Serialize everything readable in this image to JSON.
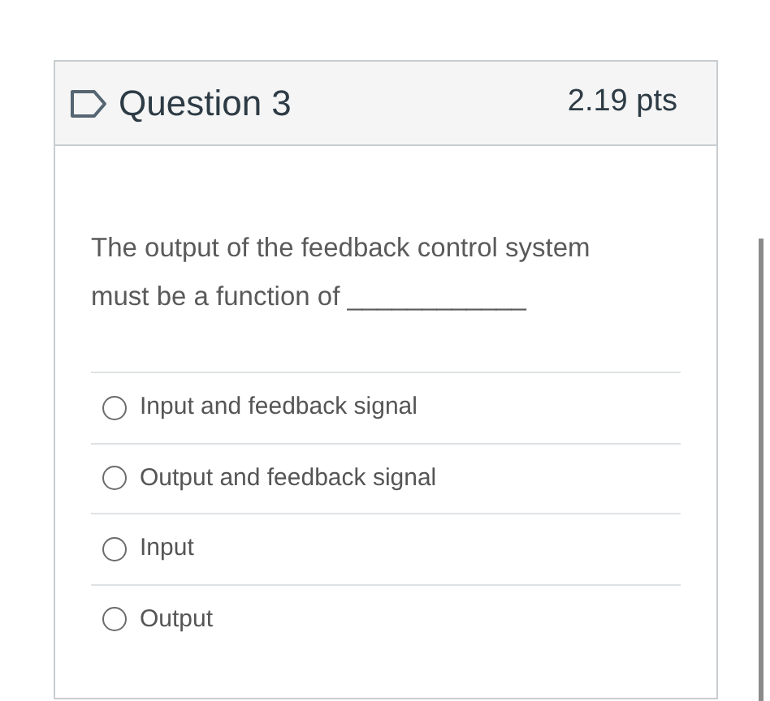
{
  "question": {
    "title": "Question 3",
    "points": "2.19 pts",
    "text": "The output of the feedback control system must be a function of ____________"
  },
  "options": [
    {
      "label": "Input and feedback signal",
      "selected": false
    },
    {
      "label": "Output and feedback signal",
      "selected": false
    },
    {
      "label": "Input",
      "selected": false
    },
    {
      "label": "Output",
      "selected": false
    }
  ]
}
